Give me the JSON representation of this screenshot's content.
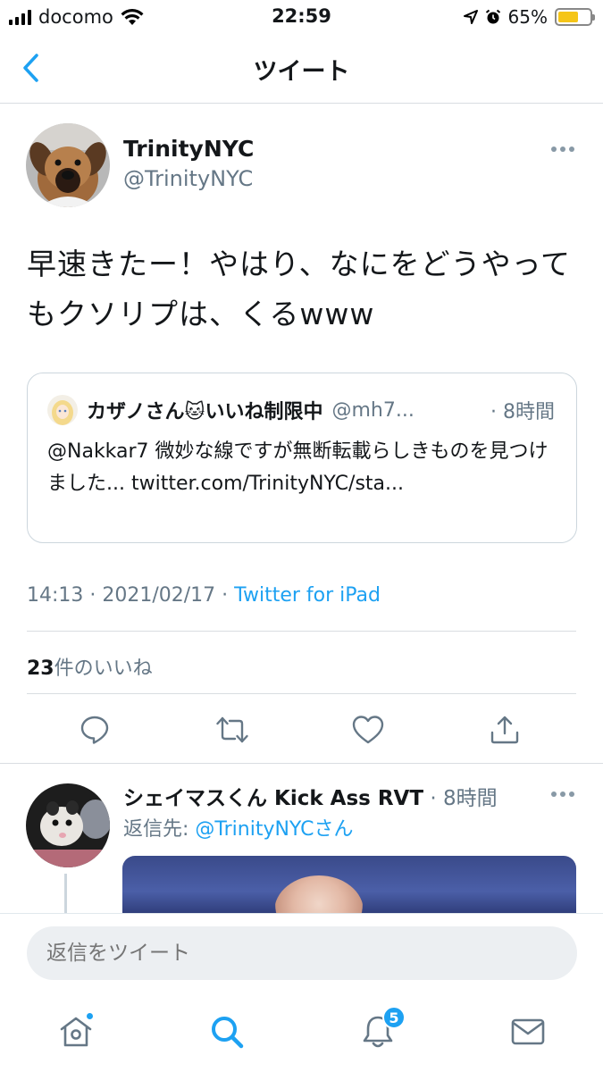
{
  "status_bar": {
    "carrier": "docomo",
    "time": "22:59",
    "battery_percent": "65%",
    "battery_level": 0.65,
    "icons": [
      "signal-icon",
      "wifi-icon",
      "location-icon",
      "alarm-icon",
      "battery-icon"
    ]
  },
  "header": {
    "title": "ツイート",
    "back_icon": "chevron-left-icon"
  },
  "tweet": {
    "name": "TrinityNYC",
    "handle": "@TrinityNYC",
    "text": "早速きたー！やはり、なにをどうやってもクソリプは、くるwww",
    "quote": {
      "name": "カザノさん🐱いいね制限中",
      "handle": "@mh7...",
      "time": "· 8時間",
      "text": "@Nakkar7 微妙な線ですが無断転載らしきものを見つけました... twitter.com/TrinityNYC/sta..."
    },
    "meta_time": "14:13 · 2021/02/17 · ",
    "meta_source": "Twitter for iPad",
    "likes_count": "23",
    "likes_label": "件のいいね",
    "actions": [
      "reply-icon",
      "retweet-icon",
      "like-icon",
      "share-icon"
    ]
  },
  "reply": {
    "name": "シェイマスくん Kick Ass RVT",
    "time": " · 8時間",
    "reply_prefix": "返信先: ",
    "reply_target": "@TrinityNYCさん"
  },
  "composer": {
    "placeholder": "返信をツイート"
  },
  "tab_bar": {
    "tabs": [
      "home-icon",
      "search-icon",
      "notifications-icon",
      "messages-icon"
    ],
    "notification_badge": "5",
    "accent": "#1da1f2"
  }
}
